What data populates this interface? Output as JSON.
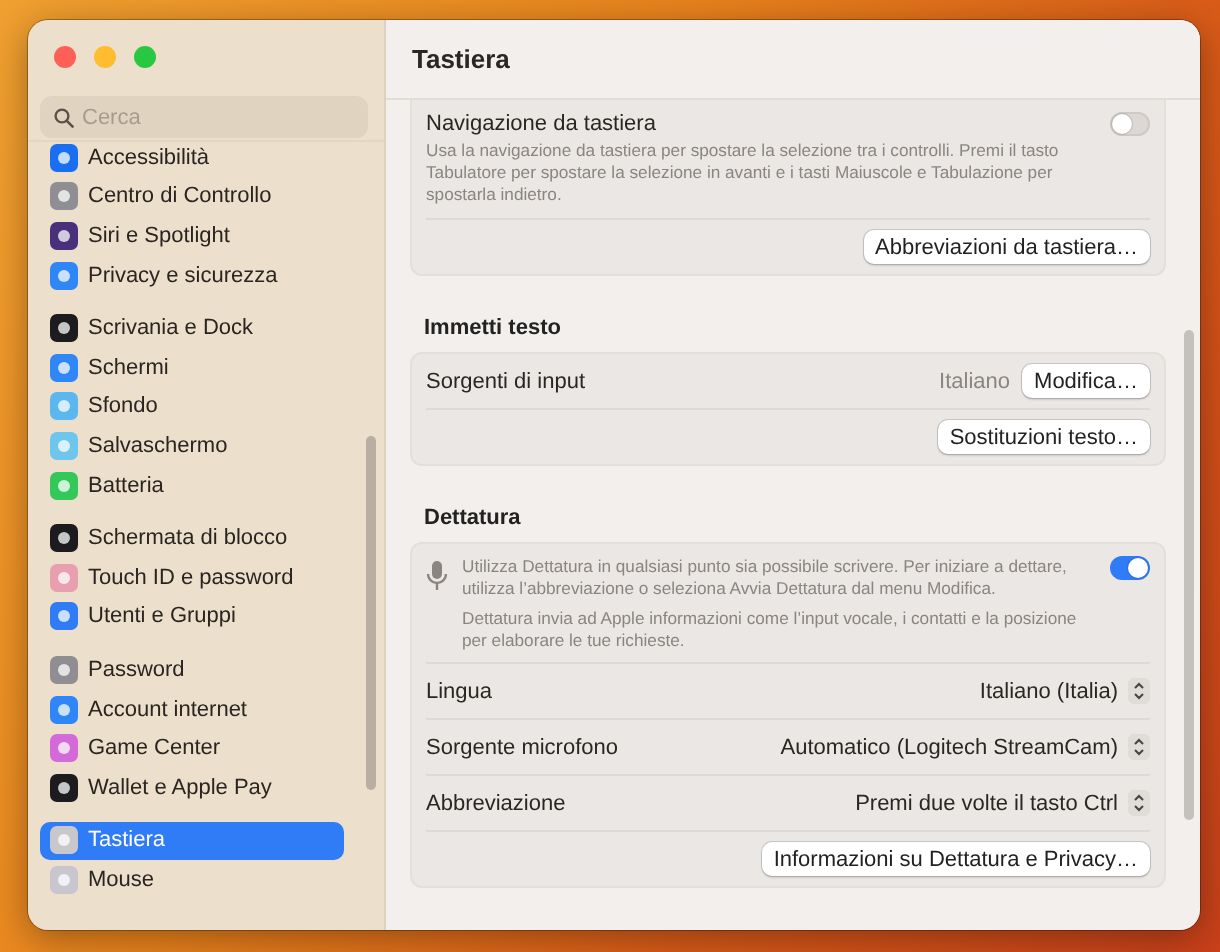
{
  "window": {
    "title": "Tastiera"
  },
  "sidebar": {
    "search": {
      "placeholder": "Cerca"
    },
    "groups": [
      [
        {
          "label": "Accessibilità",
          "color": "#1a6ff0",
          "selected": false
        },
        {
          "label": "Centro di Controllo",
          "color": "#8e8e93",
          "selected": false
        },
        {
          "label": "Siri e Spotlight",
          "color": "#4a2f7a",
          "selected": false
        },
        {
          "label": "Privacy e sicurezza",
          "color": "#2f86f6",
          "selected": false
        }
      ],
      [
        {
          "label": "Scrivania e Dock",
          "color": "#1c1c1e",
          "selected": false
        },
        {
          "label": "Schermi",
          "color": "#2f86f6",
          "selected": false
        },
        {
          "label": "Sfondo",
          "color": "#5ab8ef",
          "selected": false
        },
        {
          "label": "Salvaschermo",
          "color": "#6ec6ee",
          "selected": false
        },
        {
          "label": "Batteria",
          "color": "#34c759",
          "selected": false
        }
      ],
      [
        {
          "label": "Schermata di blocco",
          "color": "#1c1c1e",
          "selected": false
        },
        {
          "label": "Touch ID e password",
          "color": "#e8a0b0",
          "selected": false
        },
        {
          "label": "Utenti e Gruppi",
          "color": "#2f7cf6",
          "selected": false
        }
      ],
      [
        {
          "label": "Password",
          "color": "#8e8e93",
          "selected": false
        },
        {
          "label": "Account internet",
          "color": "#2f86f6",
          "selected": false
        },
        {
          "label": "Game Center",
          "color": "#d46ad8",
          "selected": false
        },
        {
          "label": "Wallet e Apple Pay",
          "color": "#1c1c1e",
          "selected": false
        }
      ],
      [
        {
          "label": "Tastiera",
          "color": "#c8c8cc",
          "selected": true
        },
        {
          "label": "Mouse",
          "color": "#c8c8cc",
          "selected": false
        }
      ]
    ]
  },
  "sections": [
    {
      "rows": [
        {
          "kind": "toggle",
          "label": "Navigazione da tastiera",
          "description": "Usa la navigazione da tastiera per spostare la selezione tra i controlli. Premi il tasto Tabulatore per spostare la selezione in avanti e i tasti Maiuscole e Tabulazione per spostarla indietro.",
          "on": false
        },
        {
          "kind": "button",
          "button": "Abbreviazioni da tastiera…"
        }
      ]
    },
    {
      "heading": "Immetti testo",
      "rows": [
        {
          "kind": "value-button",
          "label": "Sorgenti di input",
          "value": "Italiano",
          "button": "Modifica…"
        },
        {
          "kind": "button",
          "button": "Sostituzioni testo…"
        }
      ]
    },
    {
      "heading": "Dettatura",
      "rows": [
        {
          "kind": "dictation",
          "description": "Utilizza Dettatura in qualsiasi punto sia possibile scrivere. Per iniziare a dettare, utilizza l’abbreviazione o seleziona Avvia Dettatura dal menu Modifica.",
          "note": "Dettatura invia ad Apple informazioni come l’input vocale, i contatti e la posizione per elaborare le tue richieste.",
          "on": true
        },
        {
          "kind": "popup",
          "label": "Lingua",
          "value": "Italiano (Italia)"
        },
        {
          "kind": "popup",
          "label": "Sorgente microfono",
          "value": "Automatico (Logitech StreamCam)"
        },
        {
          "kind": "popup",
          "label": "Abbreviazione",
          "value": "Premi due volte il tasto Ctrl"
        },
        {
          "kind": "button",
          "button": "Informazioni su Dettatura e Privacy…"
        }
      ]
    }
  ]
}
